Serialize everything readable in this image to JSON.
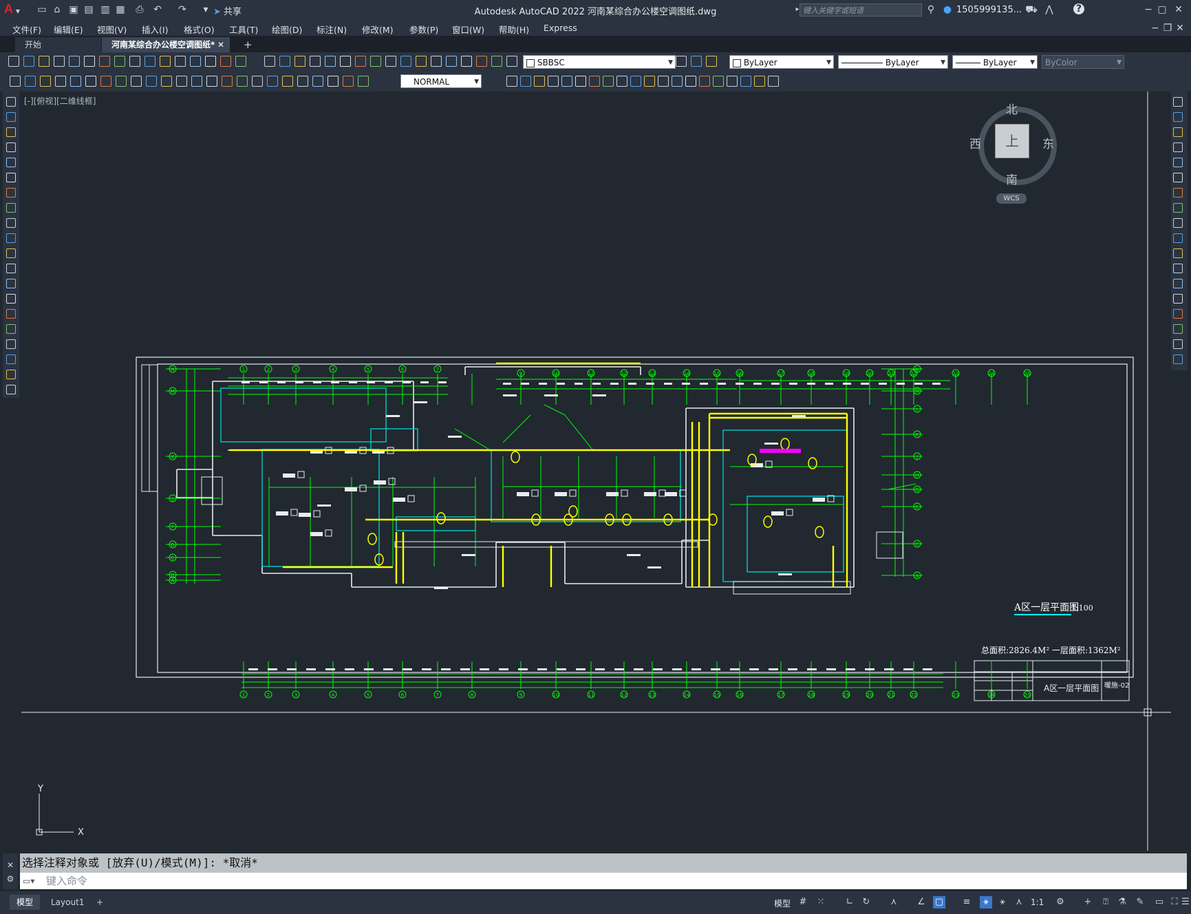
{
  "window": {
    "title": "Autodesk AutoCAD 2022    河南某综合办公楼空调图纸.dwg",
    "share_label": "共享",
    "search_placeholder": "键入关键字或短语",
    "user": "1505999135...",
    "app_letter": "A"
  },
  "menu": [
    "文件(F)",
    "编辑(E)",
    "视图(V)",
    "插入(I)",
    "格式(O)",
    "工具(T)",
    "绘图(D)",
    "标注(N)",
    "修改(M)",
    "参数(P)",
    "窗口(W)",
    "帮助(H)",
    "Express"
  ],
  "tabs": {
    "start": "开始",
    "active": "河南某综合办公楼空调图纸*",
    "add": "+"
  },
  "toolbar": {
    "layer": "SBBSC",
    "color": "ByLayer",
    "linetype": "ByLayer",
    "lineweight": "ByLayer",
    "plotstyle": "ByColor",
    "text_style": "NORMAL"
  },
  "canvas": {
    "view_label": "[-][俯视][二维线框]",
    "compass": {
      "north": "北",
      "south": "南",
      "east": "东",
      "west": "西",
      "top": "上"
    },
    "wcs": "WCS",
    "ucs_x": "X",
    "ucs_y": "Y"
  },
  "drawing": {
    "plan_title": "A区一层平面图",
    "plan_scale": "1:100",
    "area_text": "总面积:2826.4M²   一层面积:1362M²",
    "titleblock_name": "A区一层平面图",
    "titleblock_code": "暖施-02",
    "grid_top": [
      "1",
      "2",
      "3",
      "4",
      "5",
      "6",
      "7",
      "8",
      "9",
      "10",
      "11",
      "12",
      "13",
      "14",
      "15",
      "16",
      "17",
      "18",
      "19",
      "20",
      "21",
      "22",
      "23",
      "24",
      "25"
    ],
    "grid_left": [
      "N",
      "M",
      "K",
      "J",
      "F",
      "D",
      "C",
      "B",
      "A"
    ],
    "grid_right": [
      "N",
      "M",
      "L",
      "K",
      "J",
      "H",
      "G",
      "E",
      "C",
      "A"
    ]
  },
  "command": {
    "history": "选择注释对象或 [放弃(U)/模式(M)]: *取消*",
    "placeholder": "键入命令"
  },
  "status": {
    "model_label": "模型",
    "layout_tab_model": "模型",
    "layout_tab_1": "Layout1",
    "scale": "1:1"
  },
  "colors": {
    "accent_active_tab": "#3c4656",
    "grid_green": "#00ff00",
    "duct_yellow": "#ffff00",
    "wall_cyan": "#00cccc",
    "canvas_bg": "#212830"
  }
}
